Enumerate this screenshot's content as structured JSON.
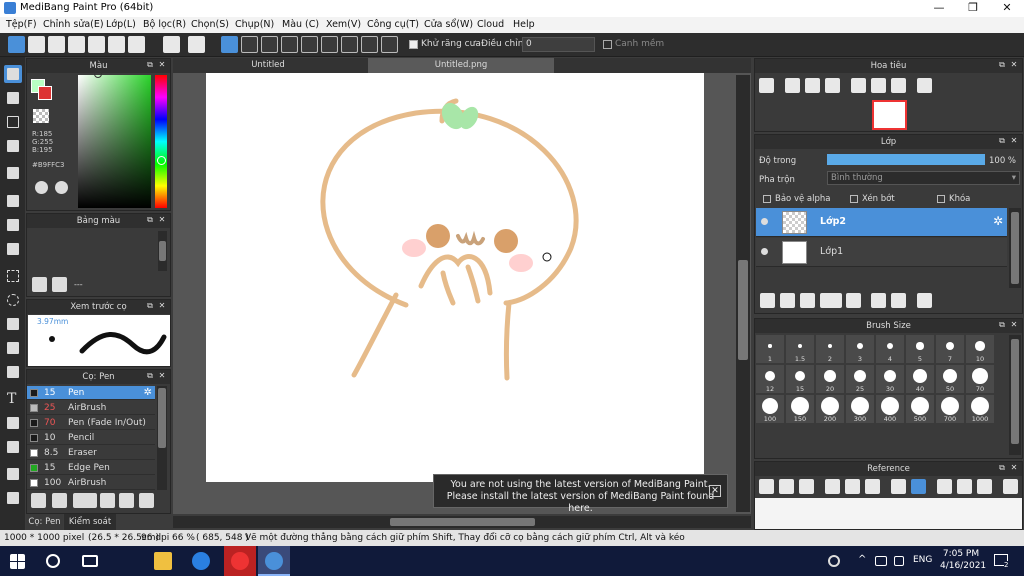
{
  "window": {
    "title": "MediBang Paint Pro (64bit)",
    "minimize": "—",
    "maximize": "❐",
    "close": "✕"
  },
  "menu": [
    "Tệp(F)",
    "Chỉnh sửa(E)",
    "Lớp(L)",
    "Bộ lọc(R)",
    "Chọn(S)",
    "Chụp(N)",
    "Màu (C)",
    "Xem(V)",
    "Công cụ(T)",
    "Cửa sổ(W)",
    "Cloud",
    "Help"
  ],
  "toolbar": {
    "antialias_label": "Khử răng cưa",
    "adjust_label": "Điều chỉnh",
    "adjust_value": "0",
    "snap_label": "Canh mềm"
  },
  "color_panel": {
    "title": "Màu",
    "r": "R:185",
    "g": "G:255",
    "b": "B:195",
    "hex": "#B9FFC3",
    "fg_color": "#B9FFC3"
  },
  "palette_panel": {
    "title": "Bảng màu",
    "more": "---"
  },
  "brush_preview": {
    "title": "Xem trước cọ",
    "size": "3.97mm"
  },
  "brush_list": {
    "title": "Cọ: Pen",
    "items": [
      {
        "size": "15",
        "name": "Pen",
        "color": "#1a1a1a",
        "selected": true
      },
      {
        "size": "25",
        "name": "AirBrush",
        "color": "#bbbbbb",
        "selected": false
      },
      {
        "size": "70",
        "name": "Pen (Fade In/Out)",
        "color": "#1a1a1a",
        "selected": false
      },
      {
        "size": "10",
        "name": "Pencil",
        "color": "#1a1a1a",
        "selected": false
      },
      {
        "size": "8.5",
        "name": "Eraser",
        "color": "#ffffff",
        "selected": false
      },
      {
        "size": "15",
        "name": "Edge Pen",
        "color": "#22aa22",
        "selected": false
      },
      {
        "size": "100",
        "name": "AirBrush",
        "color": "#ffffff",
        "selected": false
      }
    ],
    "tab_pen": "Cọ: Pen",
    "tab_control": "Kiểm soát cọ"
  },
  "canvas": {
    "tab1": "Untitled",
    "tab2": "Untitled.png"
  },
  "toast": {
    "line1": "You are not using the latest version of MediBang Paint.",
    "line2": "Please install the latest version of MediBang Paint found here.",
    "close": "✕"
  },
  "navigator": {
    "title": "Hoa tiêu"
  },
  "layers": {
    "title": "Lớp",
    "opacity_label": "Độ trong",
    "opacity_value": "100 %",
    "opacity_fraction": 1.0,
    "blend_label": "Pha trộn",
    "blend_value": "Bình thường",
    "protect_alpha": "Bảo vệ alpha",
    "clipping": "Xén bớt",
    "lock": "Khóa",
    "items": [
      {
        "name": "Lớp2",
        "selected": true
      },
      {
        "name": "Lớp1",
        "selected": false
      }
    ]
  },
  "brush_size": {
    "title": "Brush Size",
    "sizes": [
      "1",
      "1.5",
      "2",
      "3",
      "4",
      "5",
      "7",
      "10",
      "12",
      "15",
      "20",
      "25",
      "30",
      "40",
      "50",
      "70",
      "100",
      "150",
      "200",
      "300",
      "400",
      "500",
      "700",
      "1000"
    ]
  },
  "reference": {
    "title": "Reference"
  },
  "status": {
    "dims": "1000 * 1000 pixel",
    "cm": "(26.5 * 26.5cm)",
    "dpi": "96 dpi",
    "zoom": "66 %",
    "coords": "( 685, 548 )",
    "hint": "Vẽ một đường thẳng bằng cách giữ phím Shift, Thay đổi cỡ cọ bằng cách giữ phím Ctrl, Alt và kéo"
  },
  "taskbar": {
    "time": "7:05 PM",
    "date": "4/16/2021",
    "lang": "ENG",
    "notif": "2"
  }
}
